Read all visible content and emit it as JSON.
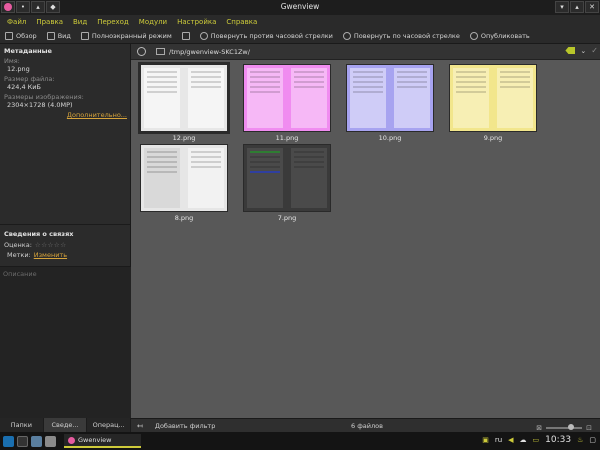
{
  "window": {
    "title": "Gwenview"
  },
  "wm": {
    "min": "▾",
    "max": "▴",
    "close": "✕",
    "pin": "•",
    "keep": "▴",
    "shade": "◆"
  },
  "menubar": [
    "Файл",
    "Правка",
    "Вид",
    "Переход",
    "Модули",
    "Настройка",
    "Справка"
  ],
  "toolbar": {
    "browse": "Обзор",
    "view": "Вид",
    "fullscreen": "Полноэкранный режим",
    "rotate_left": "Повернуть против часовой стрелки",
    "rotate_right": "Повернуть по часовой стрелке",
    "share": "Опубликовать"
  },
  "sidebar": {
    "metadata_header": "Метаданные",
    "name_label": "Имя:",
    "name_value": "12.png",
    "size_label": "Размер файла:",
    "size_value": "424,4 КиБ",
    "dims_label": "Размеры изображения:",
    "dims_value": "2304×1728 (4.0MP)",
    "more_link": "Дополнительно...",
    "links_header": "Сведения о связях",
    "rating_label": "Оценка:",
    "stars": "☆☆☆☆☆",
    "tags_label": "Метки:",
    "tags_link": "Изменить",
    "description_placeholder": "Описание",
    "tabs": [
      "Папки",
      "Сведе...",
      "Операц..."
    ]
  },
  "pathbar": {
    "path": "/tmp/gwenview-SKC1Zw/"
  },
  "thumbnails": [
    {
      "name": "12.png",
      "bg": "#e7e7e7",
      "accent": "#bdbdbd"
    },
    {
      "name": "11.png",
      "bg": "#f08cf0",
      "accent": "#d66bd6"
    },
    {
      "name": "10.png",
      "bg": "#a7a3f0",
      "accent": "#7f7ad6"
    },
    {
      "name": "9.png",
      "bg": "#f2e68c",
      "accent": "#d9c25c"
    },
    {
      "name": "8.png",
      "bg": "#e6e6e6",
      "accent": "#bcbcbc"
    },
    {
      "name": "7.png",
      "bg": "#3a3a3a",
      "accent": "#4d4d4d"
    }
  ],
  "status": {
    "add_filter": "Добавить фильтр",
    "file_count": "6 файлов"
  },
  "taskbar": {
    "app": "Gwenview",
    "lang": "ru",
    "time": "10:33"
  }
}
